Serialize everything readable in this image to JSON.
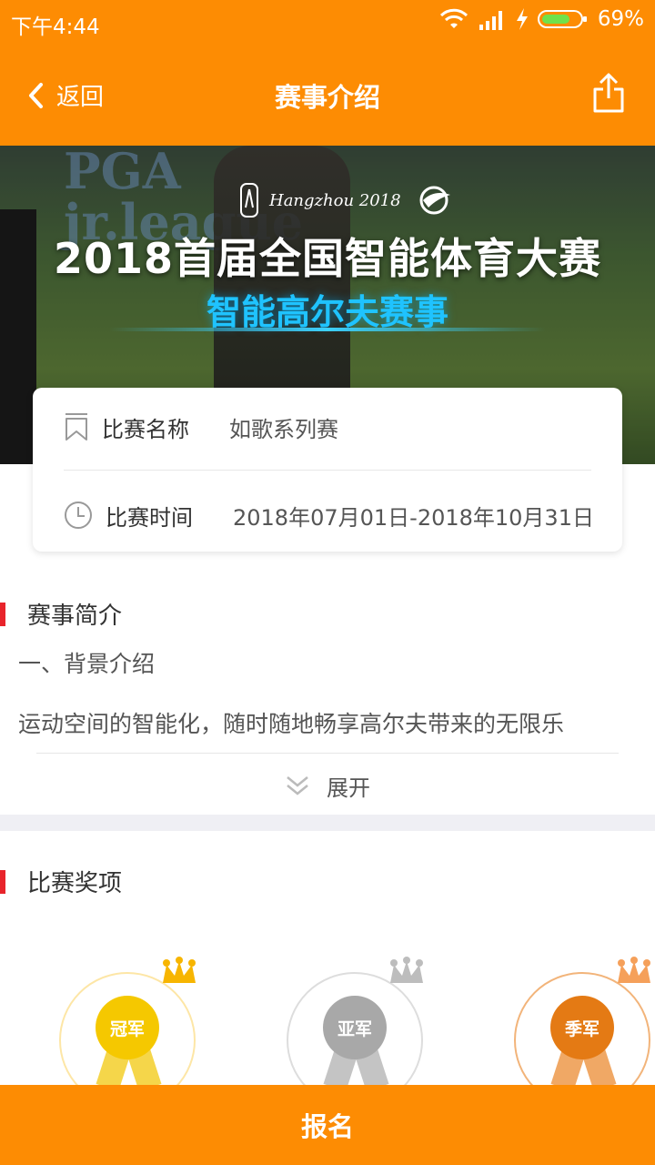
{
  "status": {
    "time": "下午4:44",
    "battery": "69%",
    "icons": [
      "wifi-icon",
      "signal-icon",
      "charging-icon",
      "battery-icon"
    ]
  },
  "nav": {
    "back_label": "返回",
    "title": "赛事介绍",
    "share_icon": "share-icon"
  },
  "banner": {
    "brand_top": "PGA",
    "brand_sub": "jr.league",
    "logo_text": "Hangzhou 2018",
    "headline": "2018首届全国智能体育大赛",
    "subtitle": "智能高尔夫赛事"
  },
  "info": {
    "name_label": "比赛名称",
    "name_value": "如歌系列赛",
    "time_label": "比赛时间",
    "time_value": "2018年07月01日-2018年10月31日"
  },
  "intro": {
    "section_title": "赛事简介",
    "subheading": "一、背景介绍",
    "text": "运动空间的智能化，随时随地畅享高尔夫带来的无限乐",
    "expand_label": "展开"
  },
  "awards": {
    "section_title": "比赛奖项",
    "medals": [
      {
        "label": "冠军",
        "color": "#f5c800",
        "ring": "#fde6a6"
      },
      {
        "label": "亚军",
        "color": "#a8a8a8",
        "ring": "#dddddd"
      },
      {
        "label": "季军",
        "color": "#e47a14",
        "ring": "#f2b47a"
      }
    ]
  },
  "footer": {
    "signup_label": "报名"
  },
  "colors": {
    "primary": "#fd8c03",
    "accent_bar": "#e8242b"
  }
}
